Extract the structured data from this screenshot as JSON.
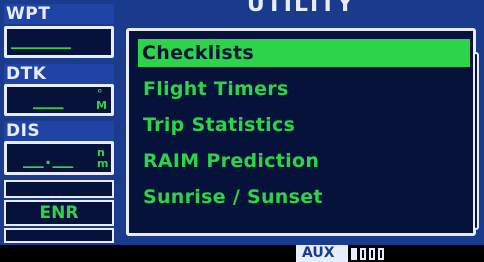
{
  "sidebar": {
    "wpt_label": "WPT",
    "wpt_value": "______",
    "dtk_label": "DTK",
    "dtk_value": "___",
    "dtk_unit_top": "°",
    "dtk_unit_bottom": "M",
    "dis_label": "DIS",
    "dis_value": "__.__",
    "dis_unit_top": "n",
    "dis_unit_bottom": "m",
    "mode": "ENR"
  },
  "main": {
    "title": "UTILITY",
    "items": [
      {
        "label": "Checklists",
        "selected": true
      },
      {
        "label": "Flight Timers",
        "selected": false
      },
      {
        "label": "Trip Statistics",
        "selected": false
      },
      {
        "label": "RAIM Prediction",
        "selected": false
      },
      {
        "label": "Sunrise / Sunset",
        "selected": false
      }
    ]
  },
  "status": {
    "page_group": "AUX",
    "page_count": 4,
    "active_page": 1
  },
  "colors": {
    "panel_blue": "#1a3a8c",
    "field_dark": "#07123a",
    "text_green": "#2dd44a",
    "frame_white": "#e8ecff"
  }
}
